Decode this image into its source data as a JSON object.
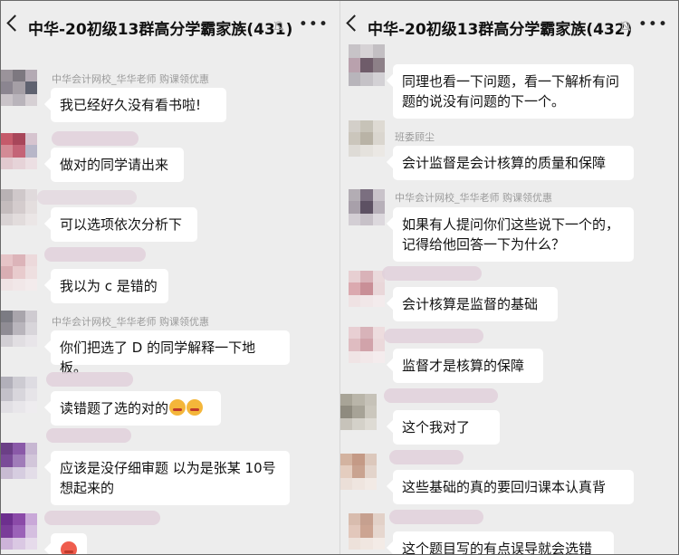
{
  "left_panel": {
    "title": "中华-20初级13群高分学霸家族(431)",
    "messages": [
      {
        "sender": "中华会计网校_华华老师 购课领优惠",
        "text": "我已经好久没有看书啦!"
      },
      {
        "sender": "",
        "text": "做对的同学请出来"
      },
      {
        "sender": "",
        "text": "可以选项依次分析下"
      },
      {
        "sender": "",
        "text": "我以为 c 是错的"
      },
      {
        "sender": "中华会计网校_华华老师 购课领优惠",
        "text": "你们把选了 D 的同学解释一下地板。"
      },
      {
        "sender": "",
        "text": "读错题了选的对的",
        "emoji": [
          "crying-laughing-emoji",
          "crying-laughing-emoji"
        ]
      },
      {
        "sender": "",
        "text": "应该是没仔细审题   以为是张某 10号想起来的"
      },
      {
        "sender": "",
        "text": "",
        "emoji": [
          "flushed-face-emoji"
        ]
      }
    ]
  },
  "right_panel": {
    "title": "中华-20初级13群高分学霸家族(432)",
    "messages": [
      {
        "sender": "",
        "text": "同理也看一下问题，看一下解析有问题的说没有问题的下一个。"
      },
      {
        "sender": "班委顾尘",
        "text": "会计监督是会计核算的质量和保障"
      },
      {
        "sender": "中华会计网校_华华老师 购课领优惠",
        "text": "如果有人提问你们这些说下一个的，记得给他回答一下为什么？"
      },
      {
        "sender": "",
        "text": "会计核算是监督的基础"
      },
      {
        "sender": "",
        "text": "监督才是核算的保障"
      },
      {
        "sender": "",
        "text": "这个我对了"
      },
      {
        "sender": "",
        "text": "这些基础的真的要回归课本认真背"
      },
      {
        "sender": "",
        "text": "这个题目写的有点误导就会选错"
      }
    ]
  },
  "icons": {
    "back": "chevron-left-icon",
    "mute": "bell-mute-icon",
    "more": "more-dots-icon"
  },
  "colors": {
    "chat_background": "#ededed",
    "bubble": "#ffffff",
    "sender_text": "#9b9b9b"
  }
}
